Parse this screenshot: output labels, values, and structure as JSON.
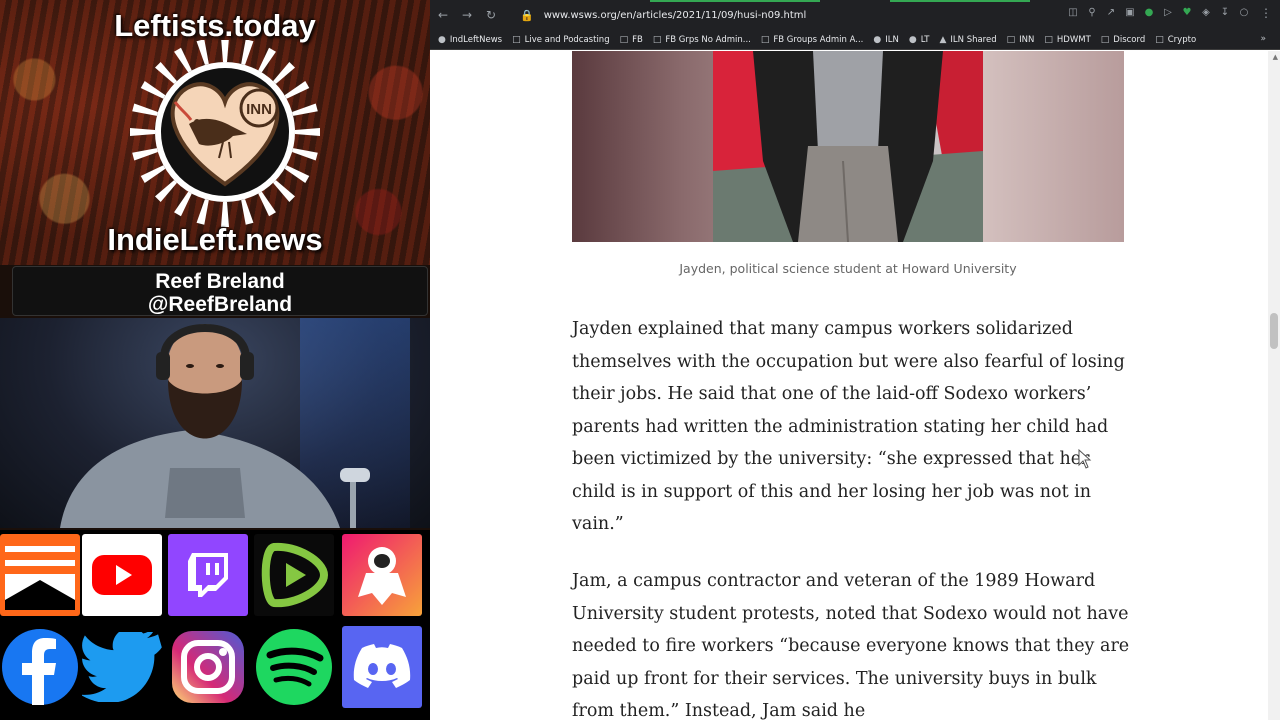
{
  "stream": {
    "brand_top": "Leftists.today",
    "brand_bottom": "IndieLeft.news",
    "logo_badge": "INN",
    "streamer_name": "Reef Breland",
    "streamer_handle": "@ReefBreland",
    "social_icons": [
      "substack-icon",
      "youtube-icon",
      "twitch-icon",
      "rumble-icon",
      "odysee-icon",
      "facebook-icon",
      "twitter-icon",
      "instagram-icon",
      "spotify-icon",
      "discord-icon"
    ]
  },
  "browser": {
    "url": "www.wsws.org/en/articles/2021/11/09/husi-n09.html",
    "bookmarks": [
      {
        "label": "IndLeftNews",
        "icon": "site-icon"
      },
      {
        "label": "Live and Podcasting",
        "icon": "folder-icon"
      },
      {
        "label": "FB",
        "icon": "folder-icon"
      },
      {
        "label": "FB Grps No Admin...",
        "icon": "folder-icon"
      },
      {
        "label": "FB Groups Admin A...",
        "icon": "folder-icon"
      },
      {
        "label": "ILN",
        "icon": "site-icon"
      },
      {
        "label": "LT",
        "icon": "site-icon"
      },
      {
        "label": "ILN Shared",
        "icon": "drive-icon"
      },
      {
        "label": "INN",
        "icon": "folder-icon"
      },
      {
        "label": "HDWMT",
        "icon": "folder-icon"
      },
      {
        "label": "Discord",
        "icon": "folder-icon"
      },
      {
        "label": "Crypto",
        "icon": "folder-icon"
      }
    ]
  },
  "article": {
    "caption": "Jayden, political science student at Howard University",
    "paragraph_1": "Jayden explained that many campus workers solidarized themselves with the occupation but were also fearful of losing their jobs. He said that one of the laid-off Sodexo workers’ parents had written the administration stating her child had been victimized by the university: “she expressed that her child is in support of this and her losing her job was not in vain.”",
    "paragraph_2": "Jam, a campus contractor and veteran of the 1989 Howard University student protests, noted that Sodexo would not have needed to fire workers “because everyone knows that they are paid up front for their services. The university buys in bulk from them.” Instead, Jam said he"
  },
  "colors": {
    "browser_chrome": "#202124",
    "load_bar": "#34a853",
    "article_text": "#222222",
    "caption_text": "#666666"
  }
}
